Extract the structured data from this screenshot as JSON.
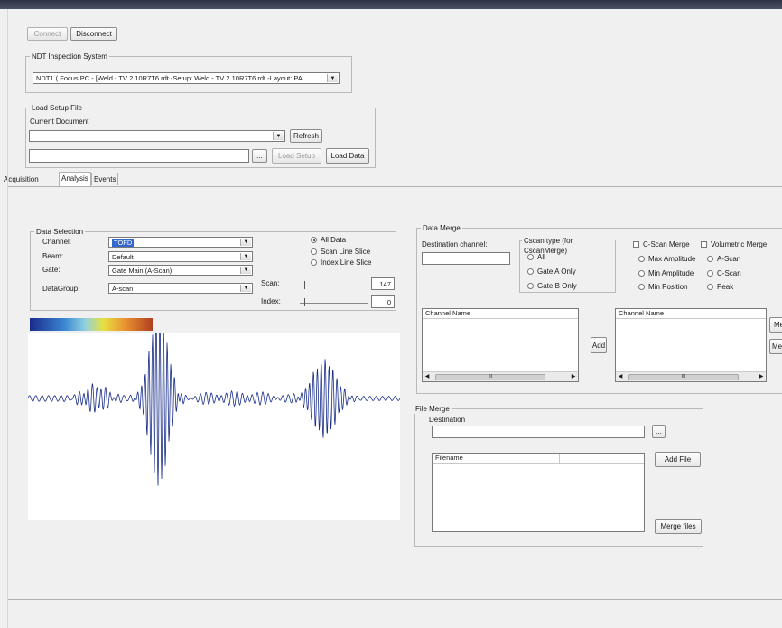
{
  "connection": {
    "connect_label": "Connect",
    "disconnect_label": "Disconnect"
  },
  "ndt": {
    "title": "NDT Inspection System",
    "selected": "NDT1 (  Focus PC         - [Weld - TV 2.10R7T6.rdt -Setup: Weld - TV 2.10R7T6.rdt -Layout: PA"
  },
  "load_setup": {
    "title": "Load Setup File",
    "current_document_label": "Current Document",
    "current_document_value": "",
    "refresh_label": "Refresh",
    "file_value": "",
    "browse_label": "...",
    "load_setup_label": "Load Setup",
    "load_data_label": "Load Data"
  },
  "tabs": [
    {
      "label": "Acquisition"
    },
    {
      "label": "Analysis"
    },
    {
      "label": "Events"
    }
  ],
  "data_selection": {
    "title": "Data Selection",
    "channel_label": "Channel:",
    "channel_value": "TOFD",
    "beam_label": "Beam:",
    "beam_value": "Default",
    "gate_label": "Gate:",
    "gate_value": "Gate Main (A-Scan)",
    "datagroup_label": "DataGroup:",
    "datagroup_value": "A-scan",
    "radio_all": "All Data",
    "radio_scan": "Scan Line Slice",
    "radio_index": "Index Line Slice",
    "scan_label": "Scan:",
    "scan_value": "147",
    "index_label": "Index:",
    "index_value": "0"
  },
  "data_merge": {
    "title": "Data Merge",
    "dest_channel_label": "Destination channel:",
    "dest_channel_value": "",
    "cscan_type_title": "Cscan type (for CscanMerge)",
    "cscan_all": "All",
    "cscan_gate_a": "Gate A Only",
    "cscan_gate_b": "Gate B Only",
    "cscan_merge_label": "C-Scan Merge",
    "max_amp": "Max Amplitude",
    "min_amp": "Min Amplitude",
    "min_pos": "Min Position",
    "volumetric_label": "Volumetric Merge",
    "vol_ascan": "A-Scan",
    "vol_cscan": "C-Scan",
    "vol_peak": "Peak",
    "channel_name_left": "Channel Name",
    "channel_name_right": "Channel Name",
    "add_label": "Add",
    "right_btn1": "Me",
    "right_btn2": "Mer",
    "scroll_grip": "III"
  },
  "file_merge": {
    "title": "File Merge",
    "destination_label": "Destination",
    "destination_value": "",
    "browse_label": "...",
    "filename_header": "Filename",
    "add_file_label": "Add File",
    "merge_files_label": "Merge files"
  },
  "waveform": {
    "samples": 180,
    "color": "#1a2e8a"
  },
  "colors": {
    "palette": [
      "#1b2a8c",
      "#3a86d0",
      "#8fd0e0",
      "#e8e040",
      "#e89030",
      "#b04020"
    ]
  }
}
